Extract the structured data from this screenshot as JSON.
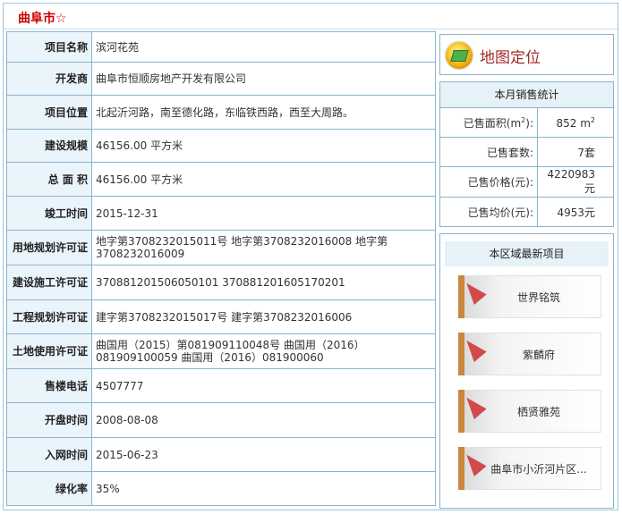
{
  "page": {
    "title": "曲阜市☆"
  },
  "details": [
    {
      "label": "项目名称",
      "value": "滨河花苑"
    },
    {
      "label": "开发商",
      "value": "曲阜市恒顺房地产开发有限公司"
    },
    {
      "label": "项目位置",
      "value": "北起沂河路，南至德化路，东临铁西路，西至大周路。"
    },
    {
      "label": "建设规模",
      "value": "46156.00 平方米"
    },
    {
      "label": "总 面 积",
      "value": "46156.00 平方米"
    },
    {
      "label": "竣工时间",
      "value": "2015-12-31"
    },
    {
      "label": "用地规划许可证",
      "value": "地字第3708232015011号 地字第3708232016008 地字第3708232016009"
    },
    {
      "label": "建设施工许可证",
      "value": "370881201506050101 370881201605170201"
    },
    {
      "label": "工程规划许可证",
      "value": "建字第3708232015017号 建字第3708232016006"
    },
    {
      "label": "土地使用许可证",
      "value": "曲国用（2015）第081909110048号 曲国用（2016）081909100059 曲国用（2016）081900060"
    },
    {
      "label": "售楼电话",
      "value": "4507777"
    },
    {
      "label": "开盘时间",
      "value": "2008-08-08"
    },
    {
      "label": "入网时间",
      "value": "2015-06-23"
    },
    {
      "label": "绿化率",
      "value": "35%"
    }
  ],
  "map": {
    "label": "地图定位",
    "icon": "map-globe-icon"
  },
  "sales": {
    "title": "本月销售统计",
    "area_label": "已售面积(m",
    "area_sup": "2",
    "area_label_end": "):",
    "area_value": "852 m",
    "area_value_sup": "2",
    "units_label": "已售套数:",
    "units_value": "7套",
    "price_label": "已售价格(元):",
    "price_value": "4220983元",
    "avg_label": "已售均价(元):",
    "avg_value": "4953元"
  },
  "recent": {
    "title": "本区域最新项目",
    "items": [
      "世界铭筑",
      "紫麟府",
      "栖贤雅苑",
      "曲阜市小沂河片区..."
    ]
  },
  "colors": {
    "title_red": "#cc0000",
    "border": "#8bb4cc",
    "label_bg": "#eaf4fb"
  }
}
